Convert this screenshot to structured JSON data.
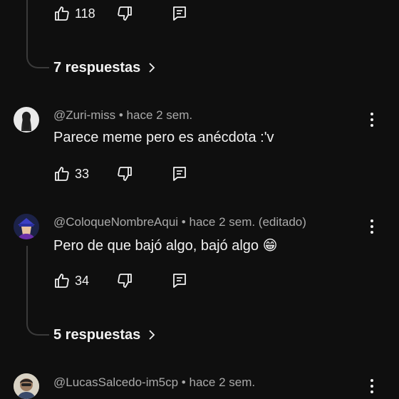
{
  "top_comment": {
    "likes": "118",
    "replies_label": "7 respuestas"
  },
  "comments": [
    {
      "author": "@Zuri-miss",
      "time": "hace 2 sem.",
      "text": "Parece meme pero es anécdota :'v",
      "likes": "33"
    },
    {
      "author": "@ColoqueNombreAqui",
      "time": "hace 2 sem. (editado)",
      "text": "Pero de que bajó algo, bajó algo 😁",
      "likes": "34",
      "replies_label": "5 respuestas"
    },
    {
      "author": "@LucasSalcedo-im5cp",
      "time": "hace 2 sem."
    }
  ],
  "separator": " • ",
  "colors": {
    "background": "#0f0f0f",
    "text": "#f1f1f1",
    "meta": "#aaaaaa",
    "thread": "#3a3a3a"
  },
  "icons": [
    "like-icon",
    "dislike-icon",
    "reply-icon",
    "more-vert-icon",
    "chevron-right-icon"
  ]
}
